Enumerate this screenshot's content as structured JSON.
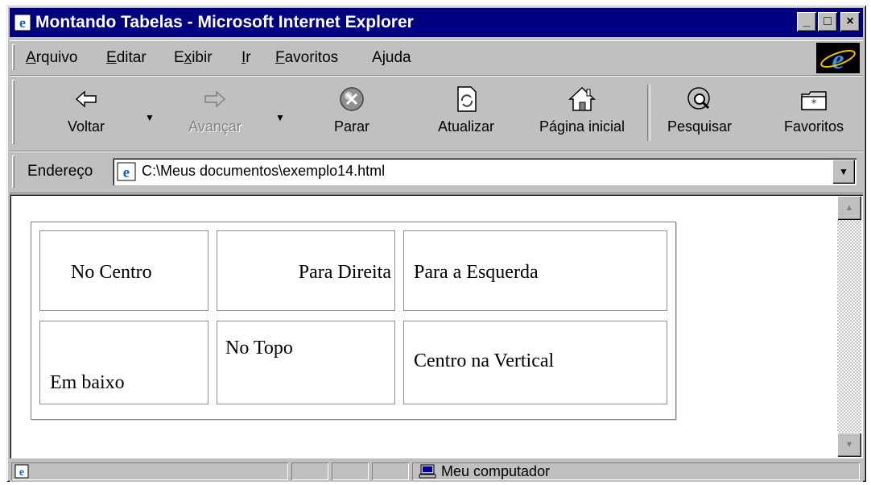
{
  "window": {
    "title": "Montando Tabelas - Microsoft Internet Explorer",
    "min_glyph": "_",
    "max_glyph": "□",
    "close_glyph": "×"
  },
  "menu": {
    "items": [
      {
        "label": "Arquivo",
        "accel": "A",
        "rest": "rquivo"
      },
      {
        "label": "Editar",
        "accel": "E",
        "rest": "ditar"
      },
      {
        "label": "Exibir",
        "pre": "E",
        "accel": "x",
        "rest": "ibir"
      },
      {
        "label": "Ir",
        "accel": "I",
        "rest": "r"
      },
      {
        "label": "Favoritos",
        "accel": "F",
        "rest": "avoritos"
      },
      {
        "label": "Ajuda",
        "pre": "A",
        "accel": "j",
        "rest": "uda"
      }
    ]
  },
  "toolbar": {
    "back": "Voltar",
    "forward": "Avançar",
    "stop": "Parar",
    "refresh": "Atualizar",
    "home": "Página inicial",
    "search": "Pesquisar",
    "favorites": "Favoritos"
  },
  "address": {
    "label": "Endereço",
    "url": "C:\\Meus documentos\\exemplo14.html"
  },
  "table": {
    "row1": [
      "No Centro",
      "Para Direita",
      "Para a Esquerda"
    ],
    "row2": [
      "Em baixo",
      "No Topo",
      "Centro na Vertical"
    ]
  },
  "status": {
    "zone": "Meu computador"
  },
  "icons": {
    "page": "ie-page-icon",
    "back": "back-arrow-icon",
    "forward": "forward-arrow-icon",
    "stop": "stop-icon",
    "refresh": "refresh-icon",
    "home": "home-icon",
    "search": "search-icon",
    "favorites": "favorites-icon",
    "computer": "computer-icon"
  },
  "colors": {
    "titlebar": "#000080",
    "chrome": "#c0c0c0"
  }
}
